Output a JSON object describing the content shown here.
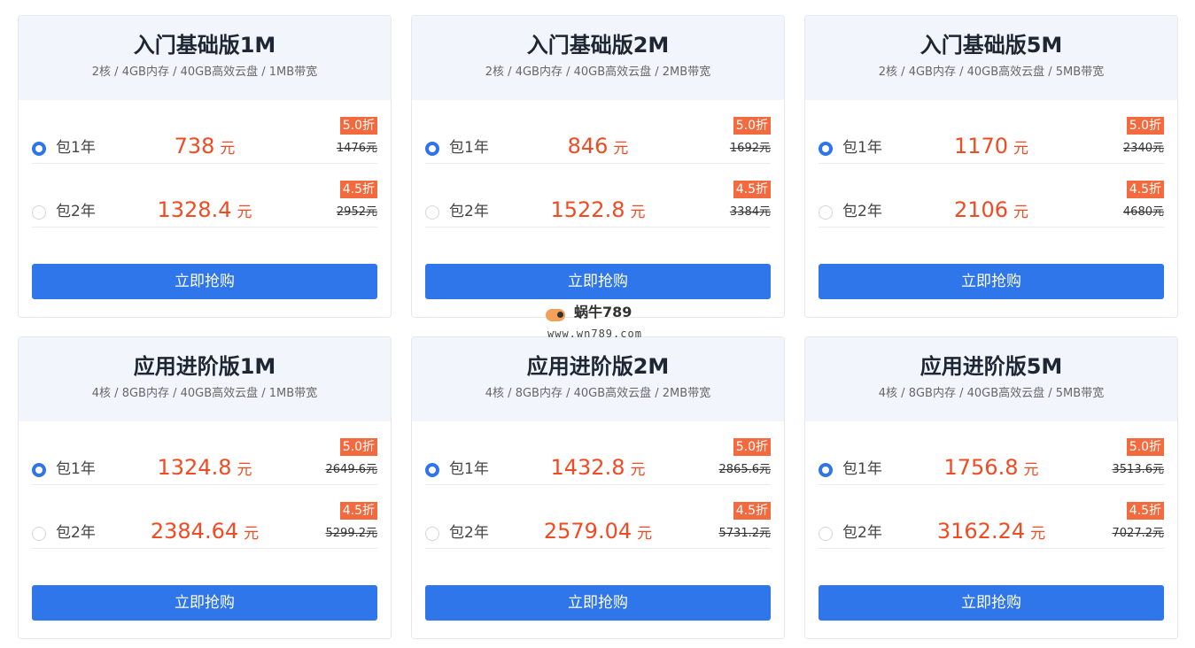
{
  "cards": [
    {
      "title": "入门基础版1M",
      "spec": "2核 / 4GB内存 / 40GB高效云盘 / 1MB带宽",
      "options": [
        {
          "label": "包1年",
          "price": "738",
          "unit": "元",
          "discount": "5.0折",
          "original": "1476元",
          "selected": true
        },
        {
          "label": "包2年",
          "price": "1328.4",
          "unit": "元",
          "discount": "4.5折",
          "original": "2952元",
          "selected": false
        }
      ],
      "button": "立即抢购"
    },
    {
      "title": "入门基础版2M",
      "spec": "2核 / 4GB内存 / 40GB高效云盘 / 2MB带宽",
      "options": [
        {
          "label": "包1年",
          "price": "846",
          "unit": "元",
          "discount": "5.0折",
          "original": "1692元",
          "selected": true
        },
        {
          "label": "包2年",
          "price": "1522.8",
          "unit": "元",
          "discount": "4.5折",
          "original": "3384元",
          "selected": false
        }
      ],
      "button": "立即抢购"
    },
    {
      "title": "入门基础版5M",
      "spec": "2核 / 4GB内存 / 40GB高效云盘 / 5MB带宽",
      "options": [
        {
          "label": "包1年",
          "price": "1170",
          "unit": "元",
          "discount": "5.0折",
          "original": "2340元",
          "selected": true
        },
        {
          "label": "包2年",
          "price": "2106",
          "unit": "元",
          "discount": "4.5折",
          "original": "4680元",
          "selected": false
        }
      ],
      "button": "立即抢购"
    },
    {
      "title": "应用进阶版1M",
      "spec": "4核 / 8GB内存 / 40GB高效云盘 / 1MB带宽",
      "options": [
        {
          "label": "包1年",
          "price": "1324.8",
          "unit": "元",
          "discount": "5.0折",
          "original": "2649.6元",
          "selected": true
        },
        {
          "label": "包2年",
          "price": "2384.64",
          "unit": "元",
          "discount": "4.5折",
          "original": "5299.2元",
          "selected": false
        }
      ],
      "button": "立即抢购"
    },
    {
      "title": "应用进阶版2M",
      "spec": "4核 / 8GB内存 / 40GB高效云盘 / 2MB带宽",
      "options": [
        {
          "label": "包1年",
          "price": "1432.8",
          "unit": "元",
          "discount": "5.0折",
          "original": "2865.6元",
          "selected": true
        },
        {
          "label": "包2年",
          "price": "2579.04",
          "unit": "元",
          "discount": "4.5折",
          "original": "5731.2元",
          "selected": false
        }
      ],
      "button": "立即抢购"
    },
    {
      "title": "应用进阶版5M",
      "spec": "4核 / 8GB内存 / 40GB高效云盘 / 5MB带宽",
      "options": [
        {
          "label": "包1年",
          "price": "1756.8",
          "unit": "元",
          "discount": "5.0折",
          "original": "3513.6元",
          "selected": true
        },
        {
          "label": "包2年",
          "price": "3162.24",
          "unit": "元",
          "discount": "4.5折",
          "original": "7027.2元",
          "selected": false
        }
      ],
      "button": "立即抢购"
    }
  ],
  "watermark": {
    "name": "蜗牛789",
    "url": "www.wn789.com"
  },
  "colors": {
    "accent": "#2e76ea",
    "price": "#f04b23",
    "badge": "#f26a3d",
    "header_bg": "#f2f6fc"
  },
  "icons": {
    "radio_selected": "radio-checked-icon",
    "radio_unselected": "radio-unchecked-icon",
    "watermark_logo": "snail-logo-icon"
  }
}
